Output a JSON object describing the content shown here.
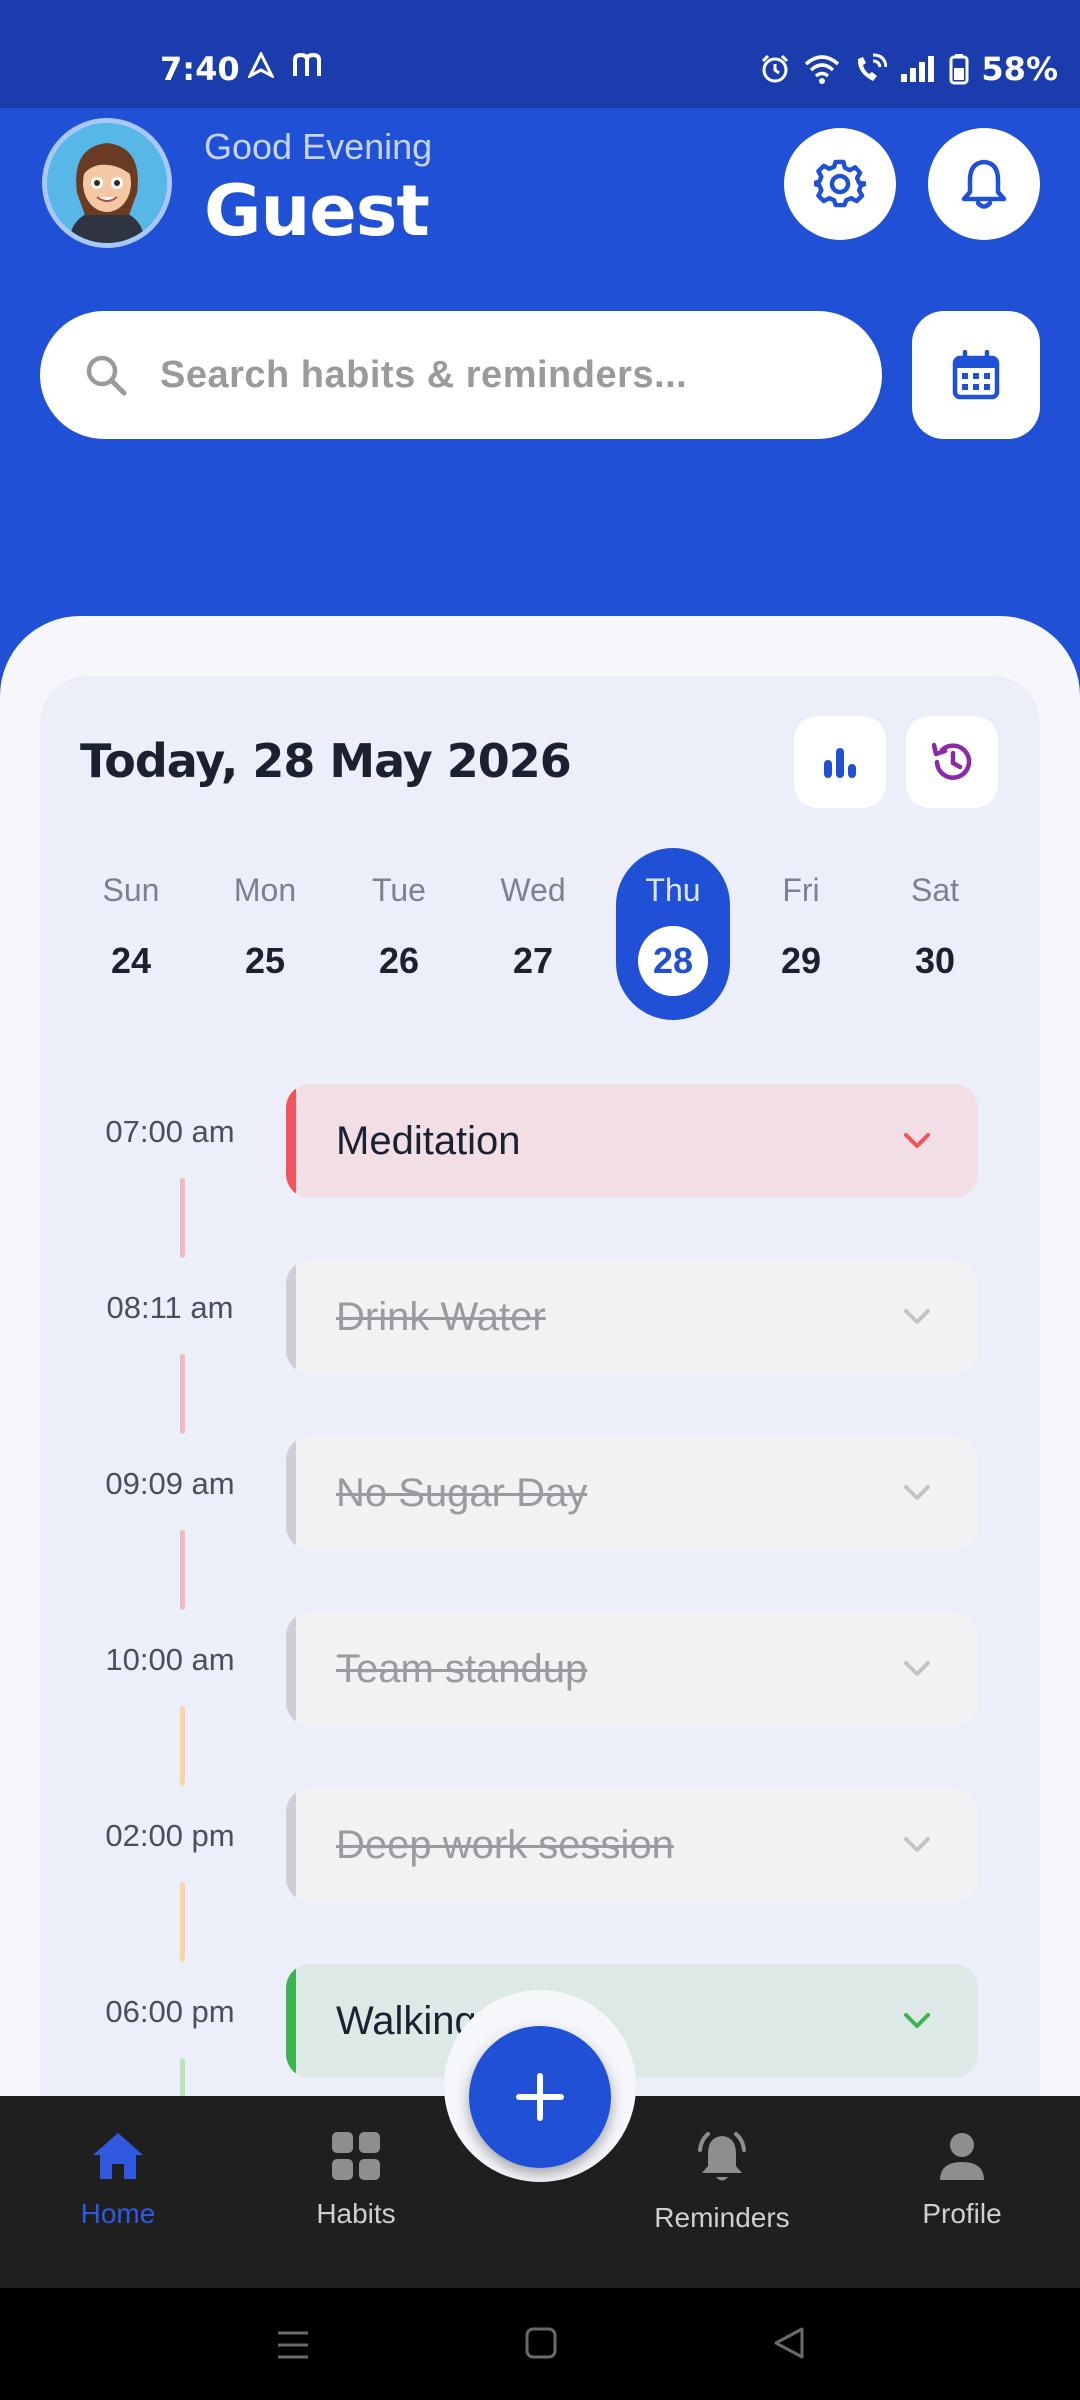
{
  "status_bar": {
    "time": "7:40",
    "battery": "58%",
    "left_icons": [
      "navigation-icon",
      "m-app-icon"
    ],
    "right_icons": [
      "alarm-icon",
      "wifi-icon",
      "wifi-call-icon",
      "signal-icon",
      "battery-icon"
    ]
  },
  "header": {
    "greeting": "Good Evening",
    "username": "Guest",
    "search_placeholder": "Search habits & reminders..."
  },
  "main": {
    "date_title": "Today, 28 May 2026",
    "week": [
      {
        "day": "Sun",
        "date": "24",
        "selected": false
      },
      {
        "day": "Mon",
        "date": "25",
        "selected": false
      },
      {
        "day": "Tue",
        "date": "26",
        "selected": false
      },
      {
        "day": "Wed",
        "date": "27",
        "selected": false
      },
      {
        "day": "Thu",
        "date": "28",
        "selected": true
      },
      {
        "day": "Fri",
        "date": "29",
        "selected": false
      },
      {
        "day": "Sat",
        "date": "30",
        "selected": false
      }
    ],
    "tasks": [
      {
        "time": "07:00 am",
        "title": "Meditation",
        "completed": false,
        "accent": "#f2545b",
        "background": "#f1dfe5",
        "chevron": "#f2545b",
        "line": "#f5b8c0"
      },
      {
        "time": "08:11 am",
        "title": "Drink Water",
        "completed": true,
        "line": "#f5b8c0"
      },
      {
        "time": "09:09 am",
        "title": "No Sugar Day",
        "completed": true,
        "line": "#f5b8c0"
      },
      {
        "time": "10:00 am",
        "title": "Team standup",
        "completed": true,
        "line": "#f7d5a8"
      },
      {
        "time": "02:00 pm",
        "title": "Deep work session",
        "completed": true,
        "line": "#f7d5a8"
      },
      {
        "time": "06:00 pm",
        "title": "Walking",
        "completed": false,
        "accent": "#3fb34f",
        "background": "#dde9e6",
        "chevron": "#3fb34f",
        "line": "#b9e2bd"
      }
    ]
  },
  "bottom_nav": {
    "items": [
      {
        "label": "Home",
        "icon": "home-icon",
        "active": true
      },
      {
        "label": "Habits",
        "icon": "grid-icon",
        "active": false
      },
      {
        "label": "Reminders",
        "icon": "bell-ring-icon",
        "active": false
      },
      {
        "label": "Profile",
        "icon": "person-icon",
        "active": false
      }
    ]
  },
  "colors": {
    "primary": "#1f50d6",
    "status_bar": "#1a3cad",
    "history_icon": "#8b2aa8"
  }
}
